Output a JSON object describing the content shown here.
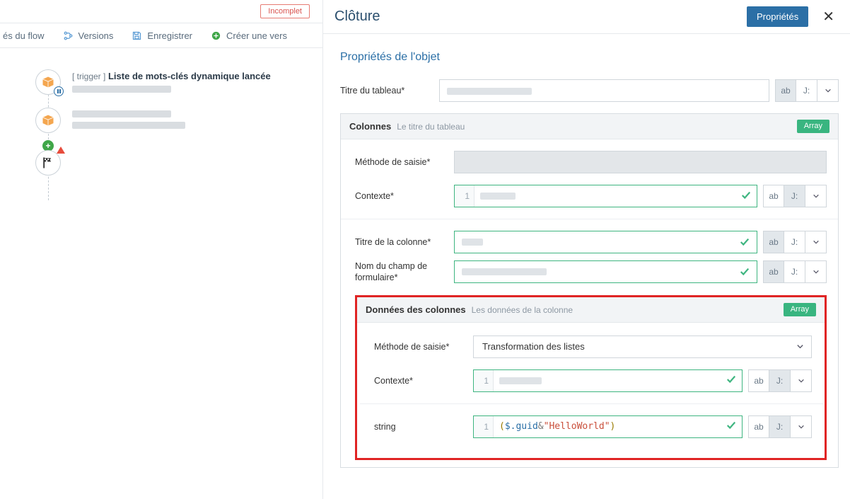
{
  "status_badge": "Incomplet",
  "toolbar": {
    "flow_label": "és du flow",
    "versions_label": "Versions",
    "save_label": "Enregistrer",
    "create_version_label": "Créer une vers"
  },
  "canvas": {
    "trigger_prefix": "[ trigger ]",
    "trigger_title": "Liste de mots-clés dynamique lancée"
  },
  "panel": {
    "title": "Clôture",
    "properties_btn": "Propriétés",
    "section_title": "Propriétés de l'objet",
    "table_title_label": "Titre du tableau*",
    "mode_ab": "ab",
    "mode_js": "J:",
    "columns": {
      "head_main": "Colonnes",
      "head_sub": "Le titre du tableau",
      "array_badge": "Array",
      "method_label": "Méthode de saisie*",
      "context_label": "Contexte*",
      "context_line": "1",
      "col_title_label": "Titre de la colonne*",
      "form_field_label_1": "Nom du champ de",
      "form_field_label_2": "formulaire*"
    },
    "column_data": {
      "head_main": "Données des colonnes",
      "head_sub": "Les données de la colonne",
      "array_badge": "Array",
      "method_label": "Méthode de saisie*",
      "method_value": "Transformation des listes",
      "context_label": "Contexte*",
      "context_line": "1",
      "string_label": "string",
      "string_line": "1",
      "expr_paren_open": "(",
      "expr_var": "$.guid",
      "expr_amp": "&",
      "expr_str": "\"HelloWorld\"",
      "expr_paren_close": ")"
    }
  }
}
